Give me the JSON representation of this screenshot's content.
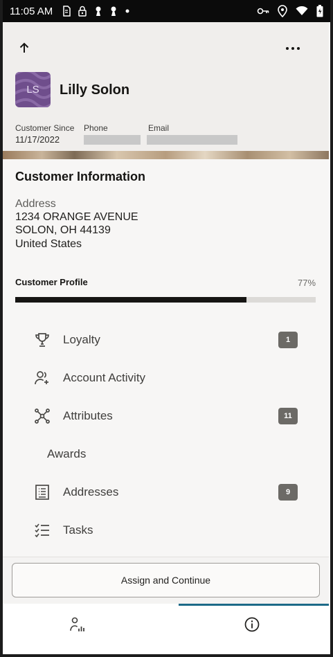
{
  "status_bar": {
    "time": "11:05 AM",
    "left_icons": [
      "sim-icon",
      "lock-icon",
      "keyhole-icon",
      "keyhole-icon",
      "dot-icon"
    ],
    "right_icons": [
      "key-icon",
      "location-icon",
      "wifi-icon",
      "battery-icon"
    ]
  },
  "header": {
    "customer_name": "Lilly Solon",
    "avatar_initials": "LS",
    "customer_since_label": "Customer Since",
    "customer_since_value": "11/17/2022",
    "phone_label": "Phone",
    "email_label": "Email"
  },
  "customer_info": {
    "title": "Customer Information",
    "address_label": "Address",
    "address_lines": [
      "1234 ORANGE AVENUE",
      "SOLON, OH 44139",
      "United States"
    ]
  },
  "profile": {
    "label": "Customer Profile",
    "percent_text": "77%",
    "percent_value": 0.77
  },
  "nav_items": [
    {
      "label": "Loyalty",
      "icon": "trophy-icon",
      "badge": "1"
    },
    {
      "label": "Account Activity",
      "icon": "users-add-icon",
      "badge": ""
    },
    {
      "label": "Attributes",
      "icon": "network-icon",
      "badge": "11"
    },
    {
      "label": "Awards",
      "icon": "",
      "badge": ""
    },
    {
      "label": "Addresses",
      "icon": "list-doc-icon",
      "badge": "9"
    },
    {
      "label": "Tasks",
      "icon": "checklist-icon",
      "badge": ""
    }
  ],
  "footer": {
    "assign_button_label": "Assign and Continue"
  },
  "tabs": [
    {
      "name": "customer-tab",
      "icon": "person-chart-icon",
      "selected": false
    },
    {
      "name": "info-tab",
      "icon": "info-icon",
      "selected": true
    }
  ],
  "colors": {
    "accent": "#1d6a88",
    "badge": "#6c6a66",
    "avatar": "#6f4e8c"
  }
}
